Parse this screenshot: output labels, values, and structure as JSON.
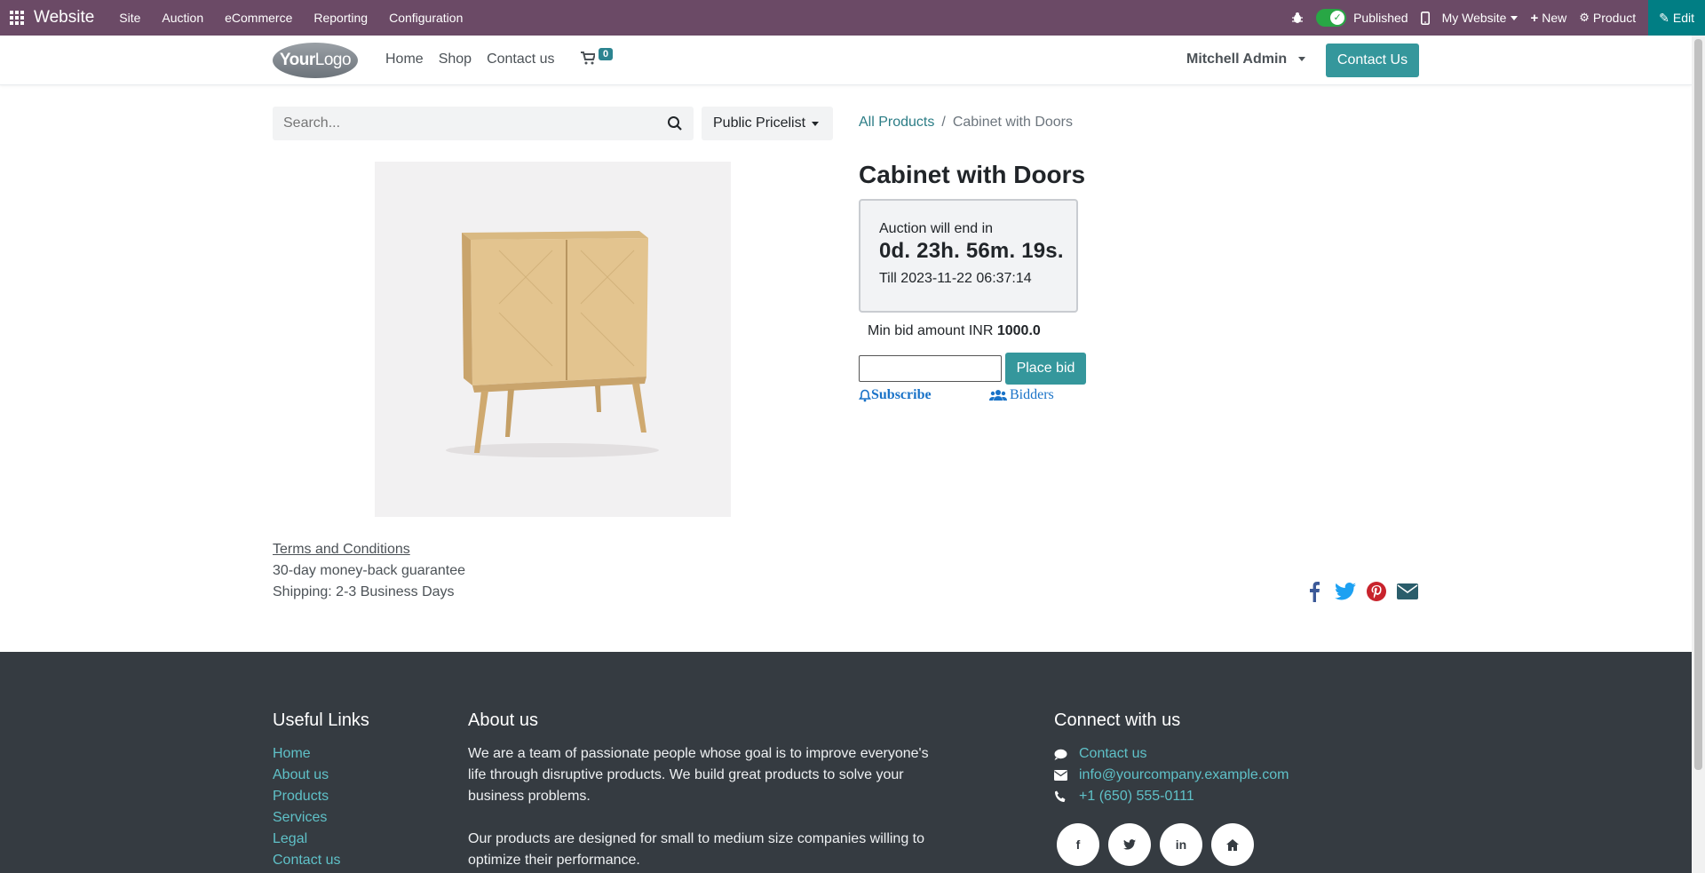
{
  "adminbar": {
    "brand": "Website",
    "menu": [
      "Site",
      "Auction",
      "eCommerce",
      "Reporting",
      "Configuration"
    ],
    "published_label": "Published",
    "website_label": "My Website",
    "new_label": "New",
    "product_label": "Product",
    "edit_label": "Edit"
  },
  "header": {
    "logo_bold": "Your",
    "logo_light": "Logo",
    "nav": [
      "Home",
      "Shop",
      "Contact us"
    ],
    "cart_count": "0",
    "user": "Mitchell Admin",
    "contact_button": "Contact Us"
  },
  "search": {
    "placeholder": "Search..."
  },
  "pricelist": {
    "label": "Public Pricelist"
  },
  "breadcrumb": {
    "all_products": "All Products",
    "separator": "/",
    "current": "Cabinet with Doors"
  },
  "product": {
    "title": "Cabinet with Doors",
    "auction": {
      "ends_label": "Auction will end in",
      "countdown": "0d. 23h. 56m. 19s.",
      "till": "Till 2023-11-22 06:37:14"
    },
    "min_bid_label": "Min bid amount INR",
    "min_bid_value": "1000.0",
    "bid_input_value": "",
    "place_bid_label": "Place bid",
    "subscribe_label": "Subscribe",
    "bidders_label": "Bidders"
  },
  "terms": {
    "link": "Terms and Conditions",
    "guarantee": "30-day money-back guarantee",
    "shipping": "Shipping: 2-3 Business Days"
  },
  "footer": {
    "useful_links_title": "Useful Links",
    "useful_links": [
      "Home",
      "About us",
      "Products",
      "Services",
      "Legal",
      "Contact us"
    ],
    "about_title": "About us",
    "about_p1": "We are a team of passionate people whose goal is to improve everyone's life through disruptive products. We build great products to solve your business problems.",
    "about_p2": "Our products are designed for small to medium size companies willing to optimize their performance.",
    "connect_title": "Connect with us",
    "connect_contact": "Contact us",
    "connect_email": "info@yourcompany.example.com",
    "connect_phone": "+1 (650) 555-0111"
  },
  "colors": {
    "admin_bar": "#6b4a66",
    "primary_button": "#35979c",
    "link": "#2c7d86",
    "footer_bg": "#353b41",
    "footer_link": "#5fc1c8"
  }
}
